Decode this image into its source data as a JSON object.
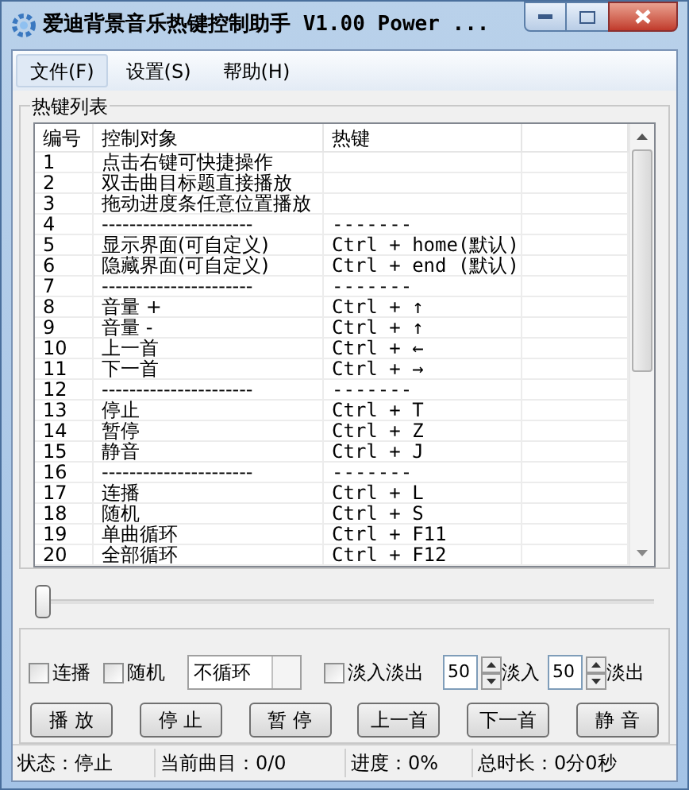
{
  "window": {
    "title": "爱迪背景音乐热键控制助手 V1.00 Power ..."
  },
  "menu": [
    {
      "label": "文件(F)",
      "selected": true
    },
    {
      "label": "设置(S)",
      "selected": false
    },
    {
      "label": "帮助(H)",
      "selected": false
    }
  ],
  "hotkey_list": {
    "title": "热键列表",
    "columns": [
      "编号",
      "控制对象",
      "热键"
    ],
    "rows": [
      [
        "1",
        "点击右键可快捷操作",
        ""
      ],
      [
        "2",
        "双击曲目标题直接播放",
        ""
      ],
      [
        "3",
        "拖动进度条任意位置播放",
        ""
      ],
      [
        "4",
        "----------------------",
        "-------"
      ],
      [
        "5",
        "显示界面(可自定义)",
        "Ctrl + home(默认)"
      ],
      [
        "6",
        "隐藏界面(可自定义)",
        "Ctrl + end (默认)"
      ],
      [
        "7",
        "----------------------",
        "-------"
      ],
      [
        "8",
        "音量 +",
        "Ctrl + ↑"
      ],
      [
        "9",
        "音量 -",
        "Ctrl + ↑"
      ],
      [
        "10",
        "上一首",
        "Ctrl + ←"
      ],
      [
        "11",
        "下一首",
        "Ctrl + →"
      ],
      [
        "12",
        "----------------------",
        "-------"
      ],
      [
        "13",
        "停止",
        "Ctrl + T"
      ],
      [
        "14",
        "暂停",
        "Ctrl + Z"
      ],
      [
        "15",
        "静音",
        "Ctrl + J"
      ],
      [
        "16",
        "----------------------",
        "-------"
      ],
      [
        "17",
        "连播",
        "Ctrl + L"
      ],
      [
        "18",
        "随机",
        "Ctrl + S"
      ],
      [
        "19",
        "单曲循环",
        "Ctrl + F11"
      ],
      [
        "20",
        "全部循环",
        "Ctrl + F12"
      ]
    ]
  },
  "progress": {
    "level": 0
  },
  "options": {
    "continuous": {
      "label": "连播",
      "checked": false
    },
    "random": {
      "label": "随机",
      "checked": false
    },
    "loop_mode": "不循环",
    "fade": {
      "label": "淡入淡出",
      "checked": false
    },
    "fade_in": {
      "value": "50",
      "label": "淡入"
    },
    "fade_out": {
      "value": "50",
      "label": "淡出"
    }
  },
  "buttons": [
    "播 放",
    "停 止",
    "暂 停",
    "上一首",
    "下一首",
    "静 音"
  ],
  "status_bar": [
    "状态：停止",
    "当前曲目：0/0",
    "进度：0%",
    "总时长：0分0秒"
  ]
}
